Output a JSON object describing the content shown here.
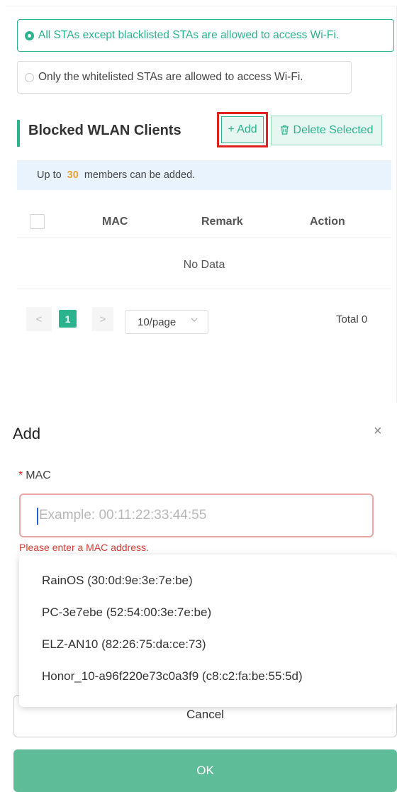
{
  "access_mode": {
    "options": [
      {
        "label": "All STAs except blacklisted STAs are allowed to access Wi-Fi.",
        "selected": true
      },
      {
        "label": "Only the whitelisted STAs are allowed to access Wi-Fi.",
        "selected": false
      }
    ]
  },
  "blocked_section": {
    "title": "Blocked WLAN Clients",
    "add_label": "+ Add",
    "delete_label": "Delete Selected",
    "info_prefix": "Up to",
    "info_count": "30",
    "info_suffix": "members can be added."
  },
  "table": {
    "columns": [
      "MAC",
      "Remark",
      "Action"
    ],
    "empty_text": "No Data"
  },
  "pagination": {
    "prev": "<",
    "current_page": "1",
    "next": ">",
    "page_size": "10/page",
    "total": "Total 0"
  },
  "dialog": {
    "title": "Add",
    "close": "×",
    "mac_required_mark": "*",
    "mac_label": "MAC",
    "mac_placeholder": "Example: 00:11:22:33:44:55",
    "error": "Please enter a MAC address.",
    "suggestions": [
      "RainOS (30:0d:9e:3e:7e:be)",
      "PC-3e7ebe (52:54:00:3e:7e:be)",
      "ELZ-AN10 (82:26:75:da:ce:73)",
      "Honor_10-a96f220e73c0a3f9 (c8:c2:fa:be:55:5d)"
    ],
    "cancel_label": "Cancel",
    "ok_label": "OK"
  },
  "colors": {
    "accent": "#2bb38d",
    "highlight_box": "#e0221c",
    "error": "#d23b32",
    "ok_button": "#5ebc98"
  }
}
